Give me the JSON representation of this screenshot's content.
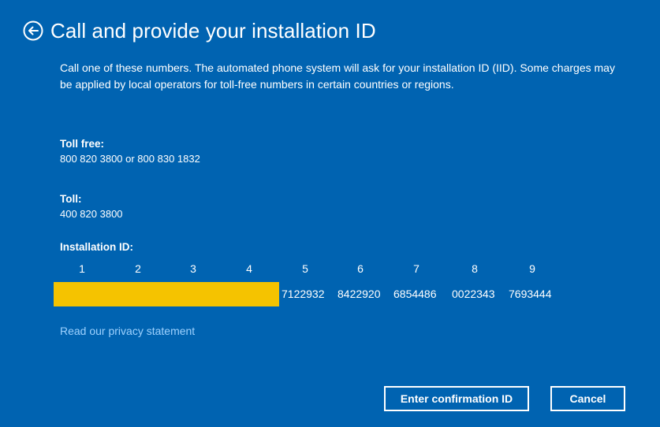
{
  "header": {
    "title": "Call and provide your installation ID"
  },
  "description": "Call one of these numbers. The automated phone system will ask for your installation ID (IID). Some charges may be applied by local operators for toll-free numbers in certain countries or regions.",
  "toll_free": {
    "label": "Toll free:",
    "value": "800 820 3800 or 800 830 1832"
  },
  "toll": {
    "label": "Toll:",
    "value": "400 820 3800"
  },
  "installation_id": {
    "label": "Installation ID:",
    "columns": [
      "1",
      "2",
      "3",
      "4",
      "5",
      "6",
      "7",
      "8",
      "9"
    ],
    "blocks": [
      "7122932",
      "8422920",
      "6854486",
      "0022343",
      "7693444"
    ]
  },
  "privacy_link": "Read our privacy statement",
  "buttons": {
    "confirm": "Enter confirmation ID",
    "cancel": "Cancel"
  },
  "colors": {
    "background": "#0063b1",
    "redaction": "#f5c300",
    "link": "#9ed2ff"
  },
  "icons": {
    "back": "back-arrow-circle-icon"
  }
}
